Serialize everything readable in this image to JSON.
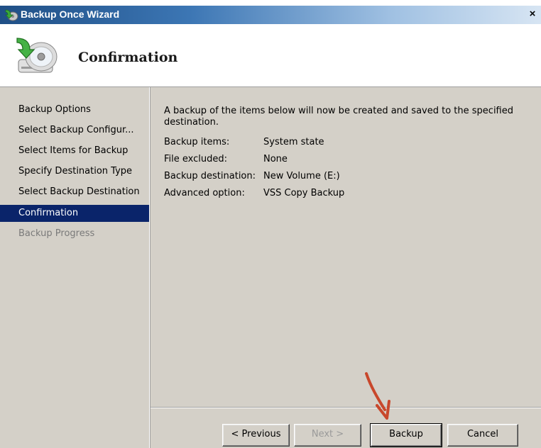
{
  "window": {
    "title": "Backup Once Wizard",
    "close_glyph": "×",
    "icon": "backup-wizard-icon"
  },
  "header": {
    "title": "Confirmation",
    "icon": "backup-disc-icon"
  },
  "nav": {
    "items": [
      {
        "label": "Backup Options",
        "state": "normal"
      },
      {
        "label": "Select Backup Configur...",
        "state": "normal"
      },
      {
        "label": "Select Items for Backup",
        "state": "normal"
      },
      {
        "label": "Specify Destination Type",
        "state": "normal"
      },
      {
        "label": "Select Backup Destination",
        "state": "normal"
      },
      {
        "label": "Confirmation",
        "state": "active"
      },
      {
        "label": "Backup Progress",
        "state": "disabled"
      }
    ]
  },
  "content": {
    "intro": "A backup of the items below will now be created and saved to the specified destination.",
    "summary": [
      {
        "key": "Backup items:",
        "value": "System state"
      },
      {
        "key": "File excluded:",
        "value": "None"
      },
      {
        "key": "Backup destination:",
        "value": "New Volume (E:)"
      },
      {
        "key": "Advanced option:",
        "value": "VSS Copy Backup"
      }
    ]
  },
  "buttons": {
    "previous": "< Previous",
    "next": "Next >",
    "backup": "Backup",
    "cancel": "Cancel"
  },
  "colors": {
    "title_gradient_start": "#1f4f86",
    "nav_active_bg": "#0a246a",
    "annotation_arrow": "#c8472b"
  }
}
